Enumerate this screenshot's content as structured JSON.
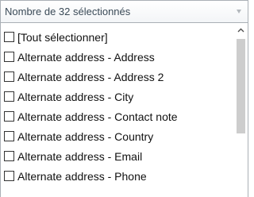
{
  "dropdown": {
    "selected_text": "Nombre de 32 sélectionnés",
    "caret_icon": "caret-down-icon"
  },
  "list": {
    "items": [
      {
        "label": "[Tout sélectionner]",
        "checked": false
      },
      {
        "label": "Alternate address - Address",
        "checked": false
      },
      {
        "label": "Alternate address - Address 2",
        "checked": false
      },
      {
        "label": "Alternate address - City",
        "checked": false
      },
      {
        "label": "Alternate address - Contact note",
        "checked": false
      },
      {
        "label": "Alternate address - Country",
        "checked": false
      },
      {
        "label": "Alternate address - Email",
        "checked": false
      },
      {
        "label": "Alternate address - Phone",
        "checked": false
      }
    ]
  },
  "scrollbar": {
    "up_icon": "chevron-up-icon",
    "scroll_position": 0
  },
  "colors": {
    "border": "#aab0b6",
    "text_header": "#3a4a57",
    "thumb": "#cdcdcd"
  }
}
